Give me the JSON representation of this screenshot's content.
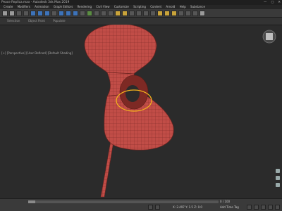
{
  "window": {
    "title": "Peace Replica.max - Autodesk 3ds Max 2019",
    "controls": [
      "—",
      "▢",
      "✕"
    ]
  },
  "menu": [
    "Create",
    "Modifiers",
    "Animation",
    "Graph Editors",
    "Rendering",
    "Civil View",
    "Customize",
    "Scripting",
    "Content",
    "Arnold",
    "Help",
    "Substance"
  ],
  "ribbon": {
    "items": [
      "Selection",
      "Object Paint",
      "Populate"
    ]
  },
  "viewport": {
    "label": "[+] [Perspective] [User Defined] [Default Shading]",
    "object_color": "#c14d47"
  },
  "status": {
    "frame": "0 / 100",
    "coords": "X: 2.497    Y: 1.5    Z: 0.0",
    "addtime": "Add Time Tag"
  }
}
